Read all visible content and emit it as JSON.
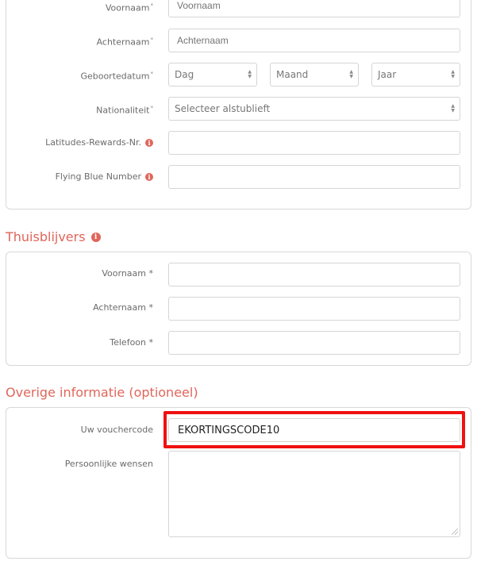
{
  "personal": {
    "first_name": {
      "label": "Voornaam",
      "required_mark": "*",
      "placeholder": "Voornaam"
    },
    "last_name": {
      "label": "Achternaam",
      "required_mark": "*",
      "placeholder": "Achternaam"
    },
    "birthdate": {
      "label": "Geboortedatum",
      "required_mark": "*",
      "day": "Dag",
      "month": "Maand",
      "year": "Jaar"
    },
    "nationality": {
      "label": "Nationaliteit",
      "required_mark": "*",
      "value": "Selecteer alstublieft"
    },
    "latitudes": {
      "label": "Latitudes-Rewards-Nr."
    },
    "flying_blue": {
      "label": "Flying Blue Number"
    }
  },
  "stay_home": {
    "title": "Thuisblijvers",
    "first_name": {
      "label": "Voornaam *"
    },
    "last_name": {
      "label": "Achternaam *"
    },
    "phone": {
      "label": "Telefoon *"
    }
  },
  "other": {
    "title": "Overige informatie (optioneel)",
    "voucher": {
      "label": "Uw vouchercode",
      "value": "EKORTINGSCODE10"
    },
    "wishes": {
      "label": "Persoonlijke wensen"
    }
  },
  "colors": {
    "accent": "#e0665a",
    "highlight": "#f01010"
  },
  "icons": {
    "info": "info-icon",
    "select": "select-arrows-icon"
  }
}
